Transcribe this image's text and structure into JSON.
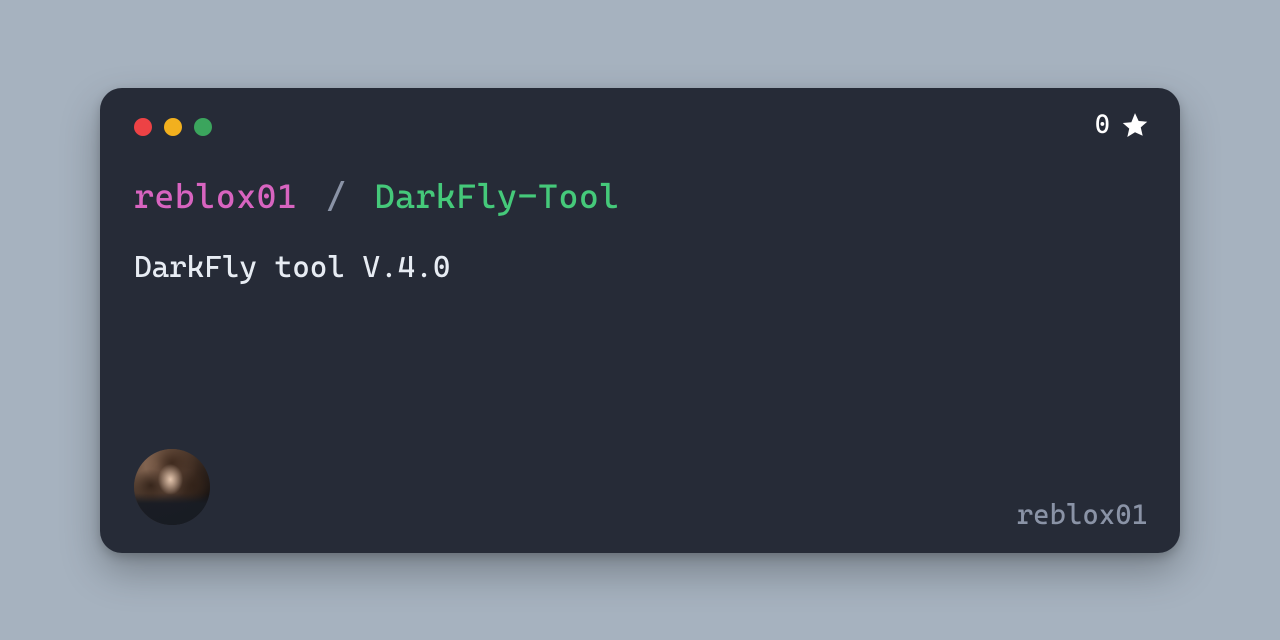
{
  "card": {
    "stars": "0",
    "owner": "reblox01",
    "separator": "/",
    "repo": "DarkFly-Tool",
    "description": "DarkFly tool V.4.0",
    "handle": "reblox01"
  }
}
